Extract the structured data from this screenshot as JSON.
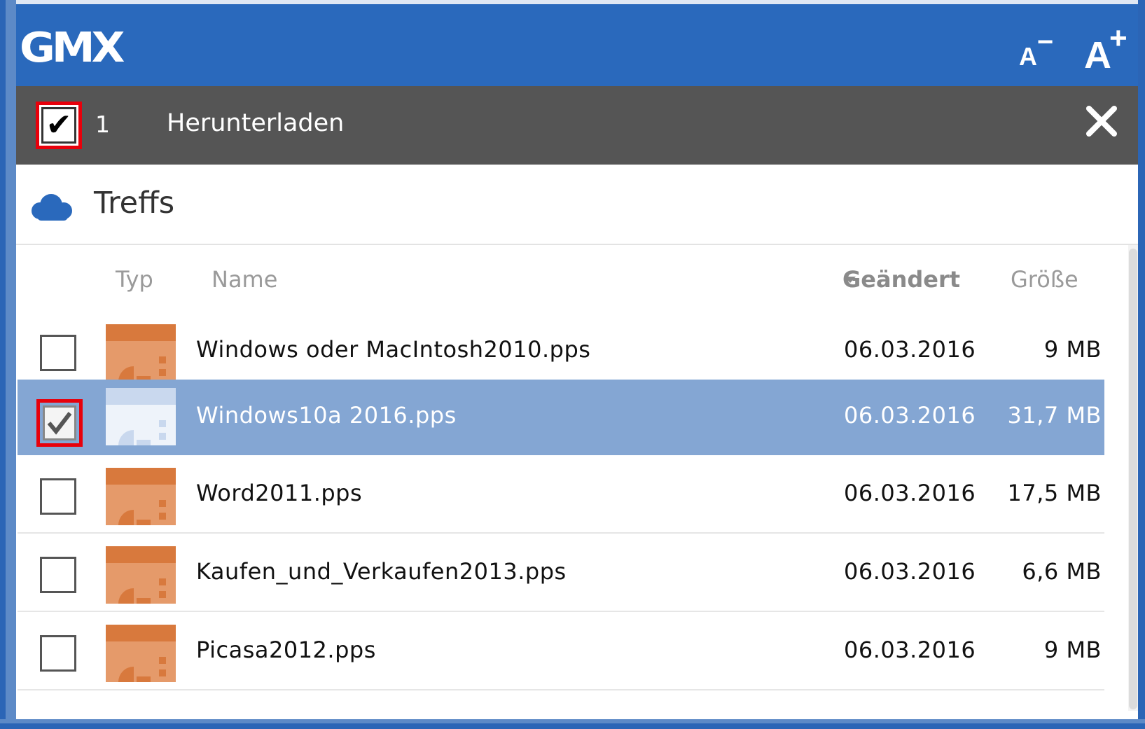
{
  "app": {
    "logo": "GMX"
  },
  "header": {
    "font_smaller": "A",
    "font_smaller_sign": "−",
    "font_larger": "A",
    "font_larger_sign": "+"
  },
  "actionbar": {
    "selected_count": "1",
    "download_label": "Herunterladen",
    "close_icon": "close-icon"
  },
  "folder": {
    "title": "Treffs",
    "icon": "cloud-icon"
  },
  "table": {
    "headers": {
      "type": "Typ",
      "name": "Name",
      "changed": "Geändert",
      "size": "Größe"
    },
    "sorted_by": "Geändert",
    "rows": [
      {
        "name": "Windows oder MacIntosh2010.pps",
        "changed": "06.03.2016",
        "size": "9 MB",
        "checked": false
      },
      {
        "name": "Windows10a 2016.pps",
        "changed": "06.03.2016",
        "size": "31,7 MB",
        "checked": true
      },
      {
        "name": "Word2011.pps",
        "changed": "06.03.2016",
        "size": "17,5 MB",
        "checked": false
      },
      {
        "name": "Kaufen_und_Verkaufen2013.pps",
        "changed": "06.03.2016",
        "size": "6,6 MB",
        "checked": false
      },
      {
        "name": "Picasa2012.pps",
        "changed": "06.03.2016",
        "size": "9 MB",
        "checked": false
      }
    ]
  },
  "colors": {
    "header_blue": "#2a69bc",
    "actionbar_gray": "#555555",
    "selected_row": "#84a6d3",
    "file_icon_orange": "#d8793d",
    "highlight_red": "#e8000b"
  }
}
